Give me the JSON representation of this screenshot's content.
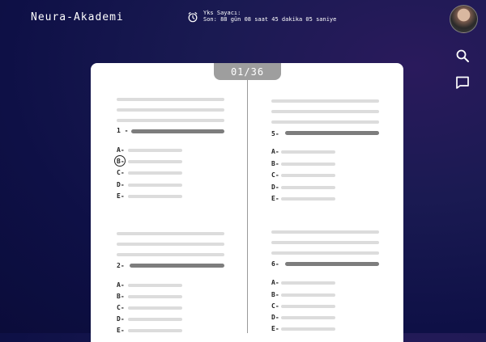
{
  "app": {
    "brand": "Neura-Akademi"
  },
  "timer": {
    "title": "Yks Sayacı:",
    "remaining": "Son: 88 gün 08 saat 45 dakika 05 saniye"
  },
  "pager": {
    "counter": "01/36"
  },
  "icons": {
    "timer": "alarm-clock-icon",
    "search": "search-icon",
    "chat": "chat-icon"
  },
  "questions": {
    "left_top": {
      "number": "1 -",
      "choices": [
        "A-",
        "B-",
        "C-",
        "D-",
        "E-"
      ],
      "selected": "B-"
    },
    "right_top": {
      "number": "5-",
      "choices": [
        "A-",
        "B-",
        "C-",
        "D-",
        "E-"
      ]
    },
    "left_bottom": {
      "number": "2-",
      "choices": [
        "A-",
        "B-",
        "C-",
        "D-",
        "E-"
      ]
    },
    "right_bottom": {
      "number": "6-",
      "choices": [
        "A-",
        "B-",
        "C-",
        "D-",
        "E-"
      ]
    }
  },
  "colors": {
    "background": "#12124a",
    "paper": "#ffffff",
    "placeholder": "#dcdcdc",
    "question_bar": "#7d7d7d",
    "counter_tab": "#9e9e9e"
  }
}
